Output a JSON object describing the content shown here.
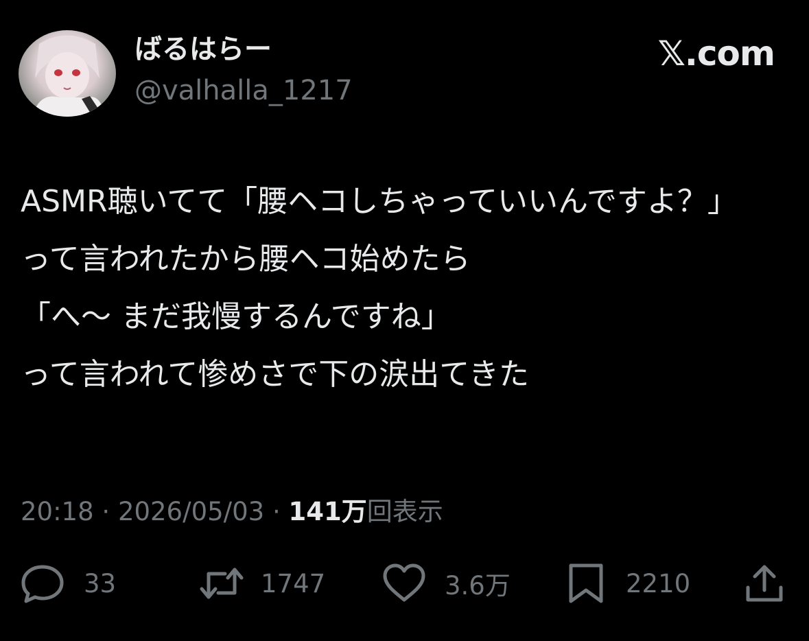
{
  "author": {
    "display_name": "ばるはらー",
    "handle": "@valhalla_1217"
  },
  "brand": "𝕏.com",
  "tweet": {
    "lines": [
      "ASMR聴いてて「腰ヘコしちゃっていいんですよ？」",
      "って言われたから腰ヘコ始めたら",
      "「へ～ まだ我慢するんですね」",
      "って言われて惨めさで下の涙出てきた"
    ]
  },
  "meta": {
    "time": "20:18",
    "separator": "·",
    "date": "2026/05/03",
    "views_count": "141万",
    "views_label": "回表示"
  },
  "actions": {
    "replies": "33",
    "reposts": "1747",
    "likes": "3.6万",
    "bookmarks": "2210"
  },
  "colors": {
    "background": "#000000",
    "text": "#e7e9ea",
    "secondary": "#71767b"
  }
}
